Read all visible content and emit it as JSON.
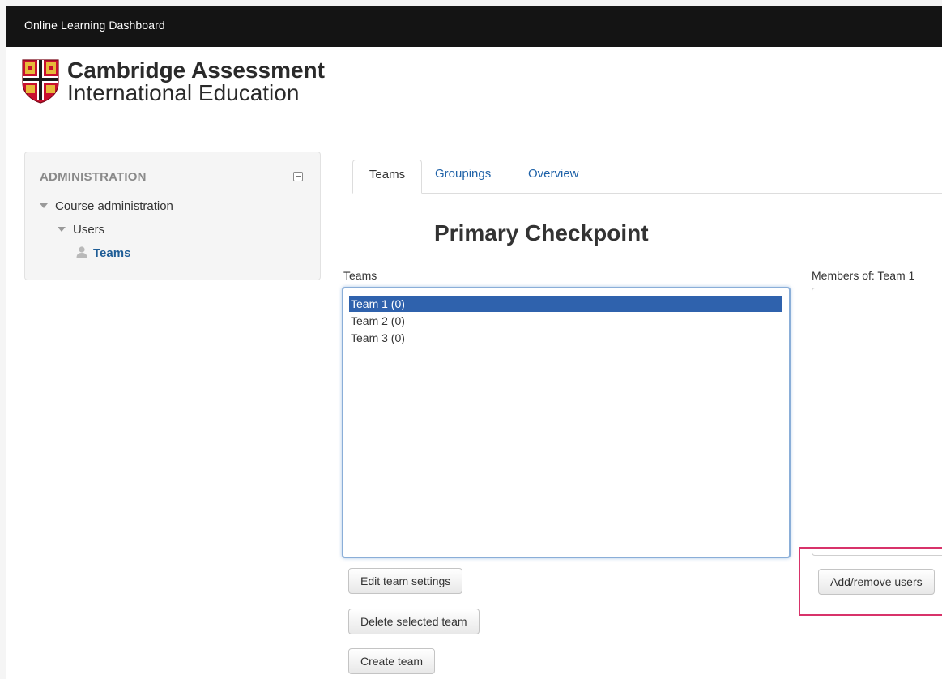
{
  "navbar": {
    "title": "Online Learning Dashboard"
  },
  "logo": {
    "line1": "Cambridge Assessment",
    "line2": "International Education"
  },
  "sidebar": {
    "title": "ADMINISTRATION",
    "items": [
      {
        "label": "Course administration"
      },
      {
        "label": "Users"
      },
      {
        "label": "Teams"
      }
    ]
  },
  "tabs": [
    {
      "label": "Teams",
      "active": true
    },
    {
      "label": "Groupings",
      "active": false
    },
    {
      "label": "Overview",
      "active": false
    }
  ],
  "main": {
    "heading": "Primary Checkpoint",
    "teams_label": "Teams",
    "members_label": "Members of: Team 1",
    "teams": [
      {
        "label": "Team 1 (0)",
        "selected": true
      },
      {
        "label": "Team 2 (0)",
        "selected": false
      },
      {
        "label": "Team 3 (0)",
        "selected": false
      }
    ],
    "buttons": {
      "edit": "Edit team settings",
      "delete": "Delete selected team",
      "create": "Create team",
      "add_remove": "Add/remove users"
    }
  },
  "colors": {
    "navbar_bg": "#141414",
    "link": "#1f62a8",
    "selected_option": "#2f62ad",
    "highlight": "#d8336a"
  }
}
